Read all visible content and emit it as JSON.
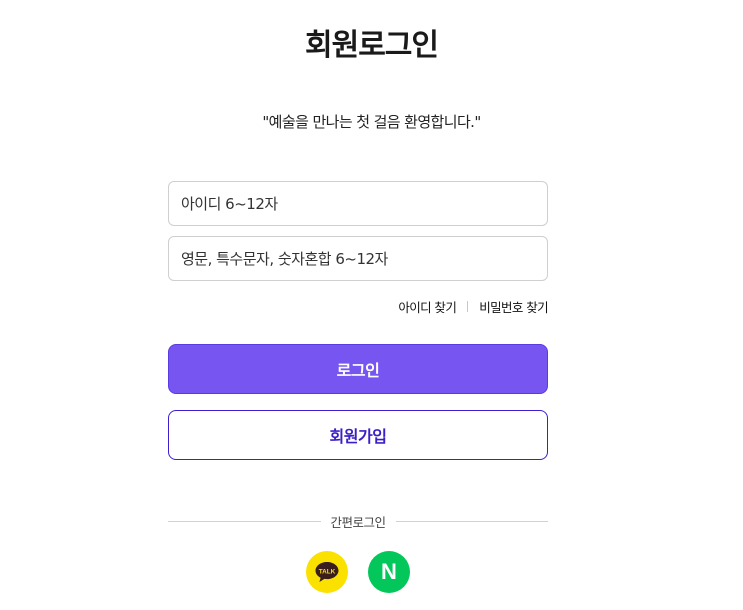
{
  "header": {
    "title": "회원로그인"
  },
  "greeting": "\"예술을 만나는 첫 걸음 환영합니다.\"",
  "form": {
    "id_placeholder": "아이디 6~12자",
    "password_placeholder": "영문, 특수문자, 숫자혼합 6~12자"
  },
  "links": {
    "find_id": "아이디 찾기",
    "find_password": "비밀번호 찾기"
  },
  "buttons": {
    "login": "로그인",
    "join": "회원가입"
  },
  "social": {
    "label": "간편로그인",
    "kakao": {
      "icon": "kakao-talk-icon",
      "text": "TALK",
      "color": "#fae100"
    },
    "naver": {
      "icon": "naver-icon",
      "text": "N",
      "color": "#03c75a"
    }
  },
  "colors": {
    "accent": "#7655f0",
    "join_border": "#3c1fd0"
  }
}
